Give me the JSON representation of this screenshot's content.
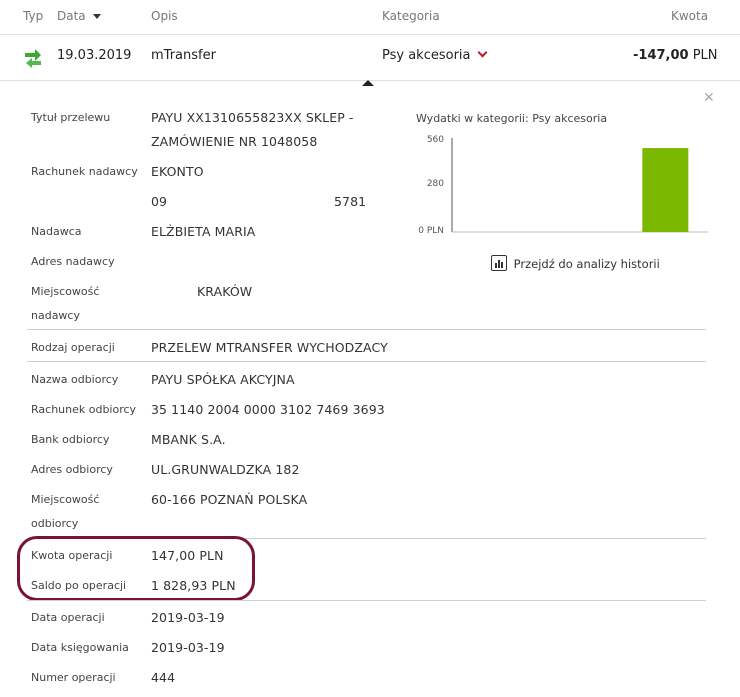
{
  "header": {
    "col_type": "Typ",
    "col_date": "Data",
    "col_desc": "Opis",
    "col_category": "Kategoria",
    "col_amount": "Kwota"
  },
  "transaction": {
    "icon": "transfer-arrows-icon",
    "date": "19.03.2019",
    "description": "mTransfer",
    "category": "Psy akcesoria",
    "amount": "-147,00",
    "currency": "PLN"
  },
  "details": {
    "title_label": "Tytuł przelewu",
    "title_line1": "PAYU XX1310655823XX SKLEP -",
    "title_line2": "ZAMÓWIENIE NR 1048058",
    "sender_account_label": "Rachunek nadawcy",
    "sender_account_name": "EKONTO",
    "sender_account_prefix": "09",
    "sender_account_suffix": "5781",
    "sender_label": "Nadawca",
    "sender_value": "ELŻBIETA MARIA",
    "sender_address_label": "Adres nadawcy",
    "sender_address_value": "",
    "sender_city_label_1": "Miejscowość",
    "sender_city_label_2": "nadawcy",
    "sender_city_value": "KRAKÓW",
    "op_type_label": "Rodzaj operacji",
    "op_type_value": "PRZELEW MTRANSFER WYCHODZACY",
    "recipient_name_label": "Nazwa odbiorcy",
    "recipient_name_value": "PAYU SPÓŁKA AKCYJNA",
    "recipient_account_label": "Rachunek odbiorcy",
    "recipient_account_value": "35 1140 2004 0000 3102 7469 3693",
    "recipient_bank_label": "Bank odbiorcy",
    "recipient_bank_value": "MBANK S.A.",
    "recipient_address_label": "Adres odbiorcy",
    "recipient_address_value": "UL.GRUNWALDZKA 182",
    "recipient_city_label_1": "Miejscowość",
    "recipient_city_label_2": "odbiorcy",
    "recipient_city_value": "60-166 POZNAŃ POLSKA",
    "op_amount_label": "Kwota operacji",
    "op_amount_value": "147,00 PLN",
    "balance_label": "Saldo po operacji",
    "balance_value": "1 828,93 PLN",
    "op_date_label": "Data operacji",
    "op_date_value": "2019-03-19",
    "posting_date_label": "Data księgowania",
    "posting_date_value": "2019-03-19",
    "op_number_label": "Numer operacji",
    "op_number_value": "444"
  },
  "chart_link_label": "Przejdź do analizy historii",
  "colors": {
    "accent_red": "#c8102e",
    "bar_green": "#7ab800",
    "highlight": "#7a1430",
    "icon_green": "#3aaa35"
  },
  "chart_data": {
    "type": "bar",
    "title": "Wydatki w kategorii:",
    "category_name": "Psy akcesoria",
    "categories": [
      "",
      "",
      ""
    ],
    "values": [
      0,
      0,
      500
    ],
    "ylim": [
      0,
      560
    ],
    "yticks": [
      "560",
      "280",
      "0 PLN"
    ],
    "grid": false
  }
}
